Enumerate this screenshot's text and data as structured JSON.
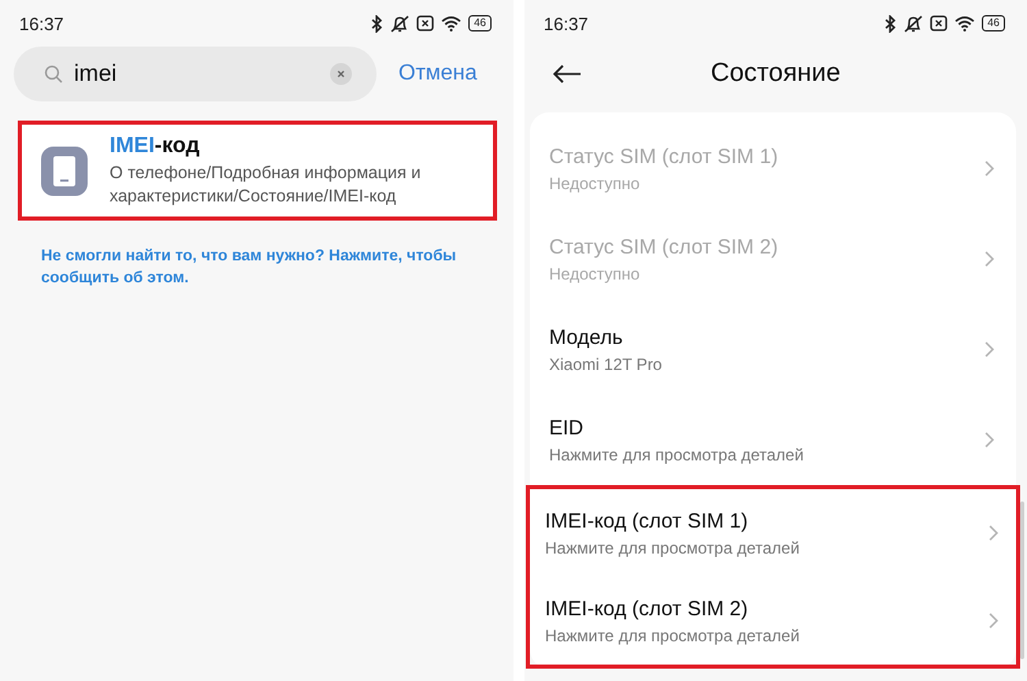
{
  "left_screen": {
    "status_bar": {
      "time": "16:37",
      "battery": "46"
    },
    "search": {
      "value": "imei"
    },
    "cancel": "Отмена",
    "results": [
      {
        "title_parts": [
          {
            "text": "IMEI",
            "highlighted": true
          },
          {
            "text": "-код",
            "highlighted": false
          }
        ],
        "path": "О телефоне/Подробная информация и характеристики/Состояние/IMEI-код",
        "marked": true
      }
    ],
    "feedback_link": "Не смогли найти то, что вам нужно? Нажмите, чтобы сообщить об этом."
  },
  "right_screen": {
    "status_bar": {
      "time": "16:37",
      "battery": "46"
    },
    "title": "Состояние",
    "items": [
      {
        "title": "Статус SIM (слот SIM 1)",
        "subtitle": "Недоступно",
        "disabled": true,
        "marked": false
      },
      {
        "title": "Статус SIM (слот SIM 2)",
        "subtitle": "Недоступно",
        "disabled": true,
        "marked": false
      },
      {
        "title": "Модель",
        "subtitle": "Xiaomi 12T Pro",
        "disabled": false,
        "marked": false
      },
      {
        "title": "EID",
        "subtitle": "Нажмите для просмотра деталей",
        "disabled": false,
        "marked": false
      },
      {
        "title": "IMEI-код (слот SIM 1)",
        "subtitle": "Нажмите для просмотра деталей",
        "disabled": false,
        "marked": true
      },
      {
        "title": "IMEI-код (слот SIM 2)",
        "subtitle": "Нажмите для просмотра деталей",
        "disabled": false,
        "marked": true
      }
    ]
  }
}
